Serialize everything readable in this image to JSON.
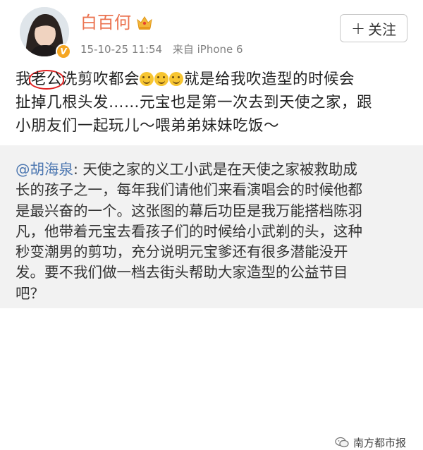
{
  "user": {
    "name": "白百何",
    "verified_badge": "V",
    "timestamp": "15-10-25 11:54",
    "source": "来自 iPhone 6"
  },
  "follow_button": {
    "label": "关注"
  },
  "post": {
    "lines": [
      {
        "before": "我",
        "circled": "老公",
        "after": "洗剪吹都会",
        "emoji_count": 3,
        "tail": "就是给我吹造型的时候会"
      },
      {
        "text": "扯掉几根头发……元宝也是第一次去到天使之家，跟"
      },
      {
        "text": "小朋友们一起玩儿～喂弟弟妹妹吃饭～"
      }
    ]
  },
  "repost": {
    "mention": "@胡海泉",
    "first_line_rest": ": 天使之家的义工小武是在天使之家被救助成",
    "lines": [
      "长的孩子之一，每年我们请他们来看演唱会的时候他都",
      "是最兴奋的一个。这张图的幕后功臣是我万能搭档陈羽",
      "凡，他带着元宝去看孩子们的时候给小武剃的头，这种",
      "秒变潮男的剪功，充分说明元宝爹还有很多潜能没开",
      "发。要不我们做一档去街头帮助大家造型的公益节目",
      "吧？"
    ]
  },
  "watermark": {
    "text": "南方都市报",
    "icon": "wechat-icon"
  },
  "colors": {
    "username": "#eb7350",
    "mention": "#4b76b0",
    "circle": "#e02020",
    "verified": "#f5a623",
    "repost_bg": "#f2f2f2"
  }
}
